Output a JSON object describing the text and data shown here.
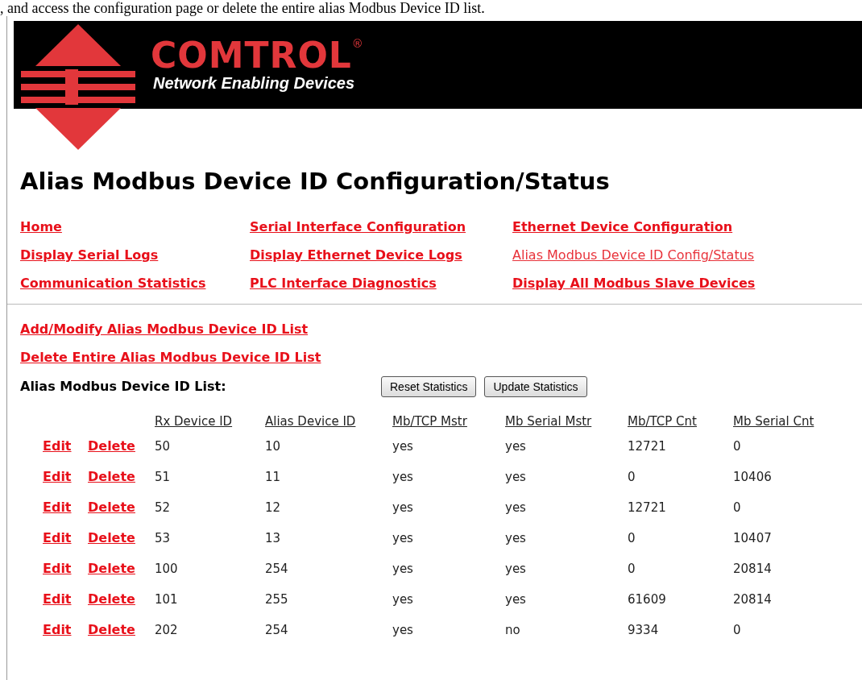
{
  "intro_line": ", and access the configuration page or delete the entire alias Modbus Device ID list.",
  "logo": {
    "name": "COMTROL",
    "mark": "®",
    "tagline": "Network Enabling Devices"
  },
  "title": "Alias Modbus Device ID Configuration/Status",
  "nav": [
    {
      "label": "Home",
      "selected": false
    },
    {
      "label": "Serial Interface Configuration",
      "selected": false
    },
    {
      "label": "Ethernet Device Configuration",
      "selected": false
    },
    {
      "label": "Display Serial Logs",
      "selected": false
    },
    {
      "label": "Display Ethernet Device Logs",
      "selected": false
    },
    {
      "label": "Alias Modbus Device ID Config/Status",
      "selected": true
    },
    {
      "label": "Communication Statistics",
      "selected": false
    },
    {
      "label": "PLC Interface Diagnostics",
      "selected": false
    },
    {
      "label": "Display All Modbus Slave Devices",
      "selected": false
    }
  ],
  "actions": [
    "Add/Modify Alias Modbus Device ID List",
    "Delete Entire Alias Modbus Device ID List"
  ],
  "list_label": "Alias Modbus Device ID List:",
  "buttons": [
    "Reset Statistics",
    "Update Statistics"
  ],
  "table": {
    "columns": [
      "Rx Device ID",
      "Alias Device ID",
      "Mb/TCP Mstr",
      "Mb Serial Mstr",
      "Mb/TCP Cnt",
      "Mb Serial Cnt"
    ],
    "rows": [
      {
        "actions": [
          "Edit",
          "Delete"
        ],
        "cells": [
          "50",
          "10",
          "yes",
          "yes",
          "12721",
          "0"
        ]
      },
      {
        "actions": [
          "Edit",
          "Delete"
        ],
        "cells": [
          "51",
          "11",
          "yes",
          "yes",
          "0",
          "10406"
        ]
      },
      {
        "actions": [
          "Edit",
          "Delete"
        ],
        "cells": [
          "52",
          "12",
          "yes",
          "yes",
          "12721",
          "0"
        ]
      },
      {
        "actions": [
          "Edit",
          "Delete"
        ],
        "cells": [
          "53",
          "13",
          "yes",
          "yes",
          "0",
          "10407"
        ]
      },
      {
        "actions": [
          "Edit",
          "Delete"
        ],
        "cells": [
          "100",
          "254",
          "yes",
          "yes",
          "0",
          "20814"
        ]
      },
      {
        "actions": [
          "Edit",
          "Delete"
        ],
        "cells": [
          "101",
          "255",
          "yes",
          "yes",
          "61609",
          "20814"
        ]
      },
      {
        "actions": [
          "Edit",
          "Delete"
        ],
        "cells": [
          "202",
          "254",
          "yes",
          "no",
          "9334",
          "0"
        ]
      }
    ]
  }
}
